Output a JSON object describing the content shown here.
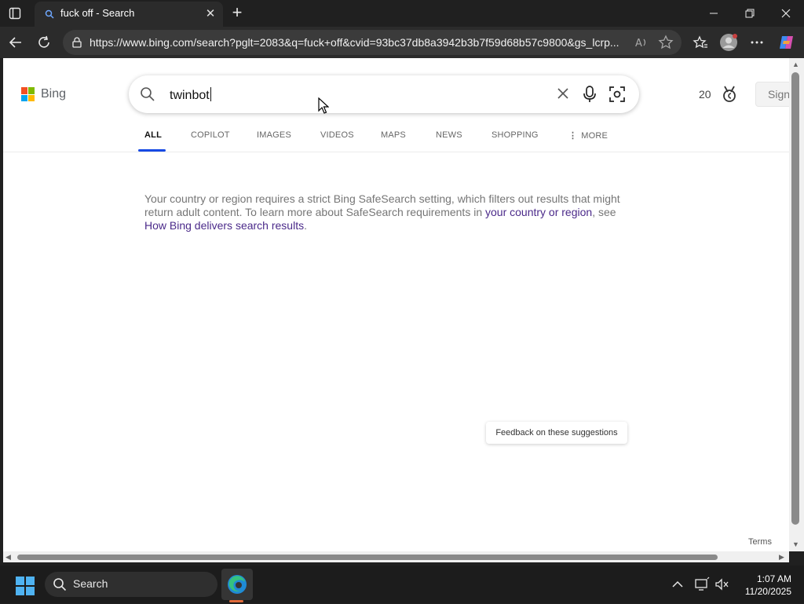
{
  "browser": {
    "tab_title": "fuck off - Search",
    "url": "https://www.bing.com/search?pglt=2083&q=fuck+off&cvid=93bc37db8a3942b3b7f59d68b57c9800&gs_lcrp..."
  },
  "page": {
    "logo_text": "Bing",
    "search_value": "twinbot",
    "rewards_count": "20",
    "signin_label": "Sign",
    "scopes": [
      "ALL",
      "COPILOT",
      "IMAGES",
      "VIDEOS",
      "MAPS",
      "NEWS",
      "SHOPPING",
      "MORE"
    ],
    "notice": {
      "part1": "Your country or region requires a strict Bing SafeSearch setting, which filters out results that might return adult content. To learn more about SafeSearch requirements in ",
      "link1": "your country or region",
      "part2": ", see ",
      "link2": "How Bing delivers search results",
      "part3": "."
    },
    "feedback_label": "Feedback on these suggestions",
    "terms_label": "Terms"
  },
  "taskbar": {
    "search_label": "Search",
    "time": "1:07 AM",
    "date": "11/20/2025"
  },
  "colors": {
    "accent_blue": "#174ae4",
    "link_purple": "#4b2a8a",
    "edge_indicator": "#e06a3a"
  }
}
